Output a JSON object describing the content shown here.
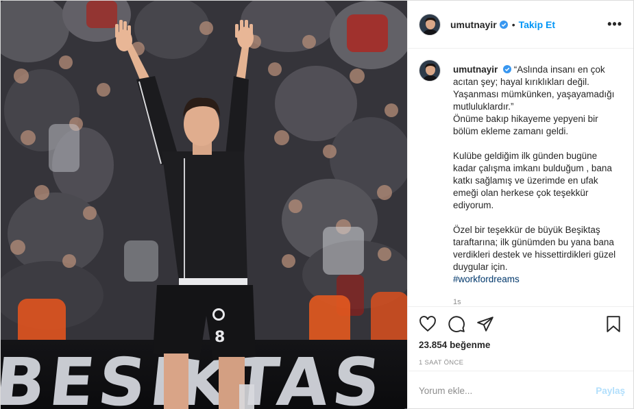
{
  "photo": {
    "banner_text": "BESİKTAS JK",
    "shirt_number": "8"
  },
  "header": {
    "username": "umutnayir",
    "verified_icon": "verified-badge-icon",
    "separator": "•",
    "follow_label": "Takip Et",
    "more_label": "•••"
  },
  "caption": {
    "username": "umutnayir",
    "lines": [
      "“Aslında insanı en çok acıtan şey; hayal kırıklıkları değil. Yaşanması mümkünken, yaşayamadığı mutluluklardır.”",
      "Önüme bakıp hikayeme yepyeni bir bölüm ekleme zamanı geldi."
    ],
    "paragraph_2": "Kulübe geldiğim ilk günden bugüne kadar çalışma imkanı bulduğum , bana katkı sağlamış ve üzerimde en ufak emeği olan herkese çok teşekkür ediyorum.",
    "paragraph_3": "Özel bir teşekkür de büyük Beşiktaş taraftarına; ilk günümden bu yana bana verdikleri destek ve hissettirdikleri güzel duygular için.",
    "hashtag": "#workfordreams",
    "time": "1s"
  },
  "actions": {
    "icons": [
      "heart-icon",
      "comment-icon",
      "share-icon",
      "bookmark-icon"
    ],
    "likes_count": "23.854",
    "likes_label": "beğenme",
    "posted_ago": "1 SAAT ÖNCE"
  },
  "comment": {
    "placeholder": "Yorum ekle...",
    "post_label": "Paylaş"
  },
  "colors": {
    "accent": "#0095f6",
    "hashtag": "#00376b",
    "muted": "#8e8e8e",
    "post_disabled": "#b2dffc"
  }
}
